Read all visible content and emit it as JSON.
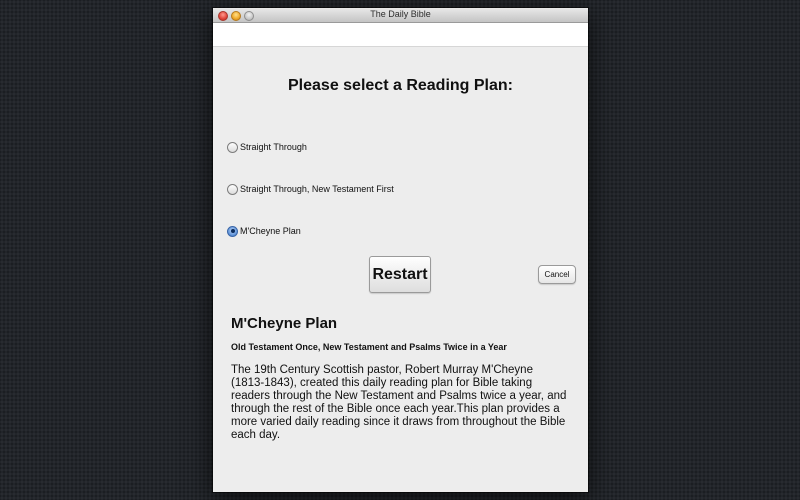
{
  "window": {
    "title": "The Daily Bible"
  },
  "main": {
    "heading": "Please select a Reading Plan:",
    "plans": [
      {
        "label": "Straight Through",
        "selected": false
      },
      {
        "label": "Straight Through, New Testament First",
        "selected": false
      },
      {
        "label": "M'Cheyne Plan",
        "selected": true
      }
    ],
    "restart_label": "Restart",
    "cancel_label": "Cancel"
  },
  "description": {
    "title": "M'Cheyne Plan",
    "subtitle": "Old Testament Once, New Testament and Psalms Twice in a Year",
    "body": "The 19th Century Scottish pastor, Robert Murray M'Cheyne (1813-1843), created this daily reading plan for Bible taking readers through the New Testament and Psalms twice a year, and through the rest of the Bible once each year.This plan provides a more varied daily reading since it draws from throughout the Bible each day."
  },
  "colors": {
    "desktop": "#22252a",
    "window_bg": "#ededed",
    "radio_selected": "#3a66a8"
  },
  "icons": {
    "close": "close-icon",
    "minimize": "minimize-icon",
    "zoom": "zoom-icon"
  }
}
